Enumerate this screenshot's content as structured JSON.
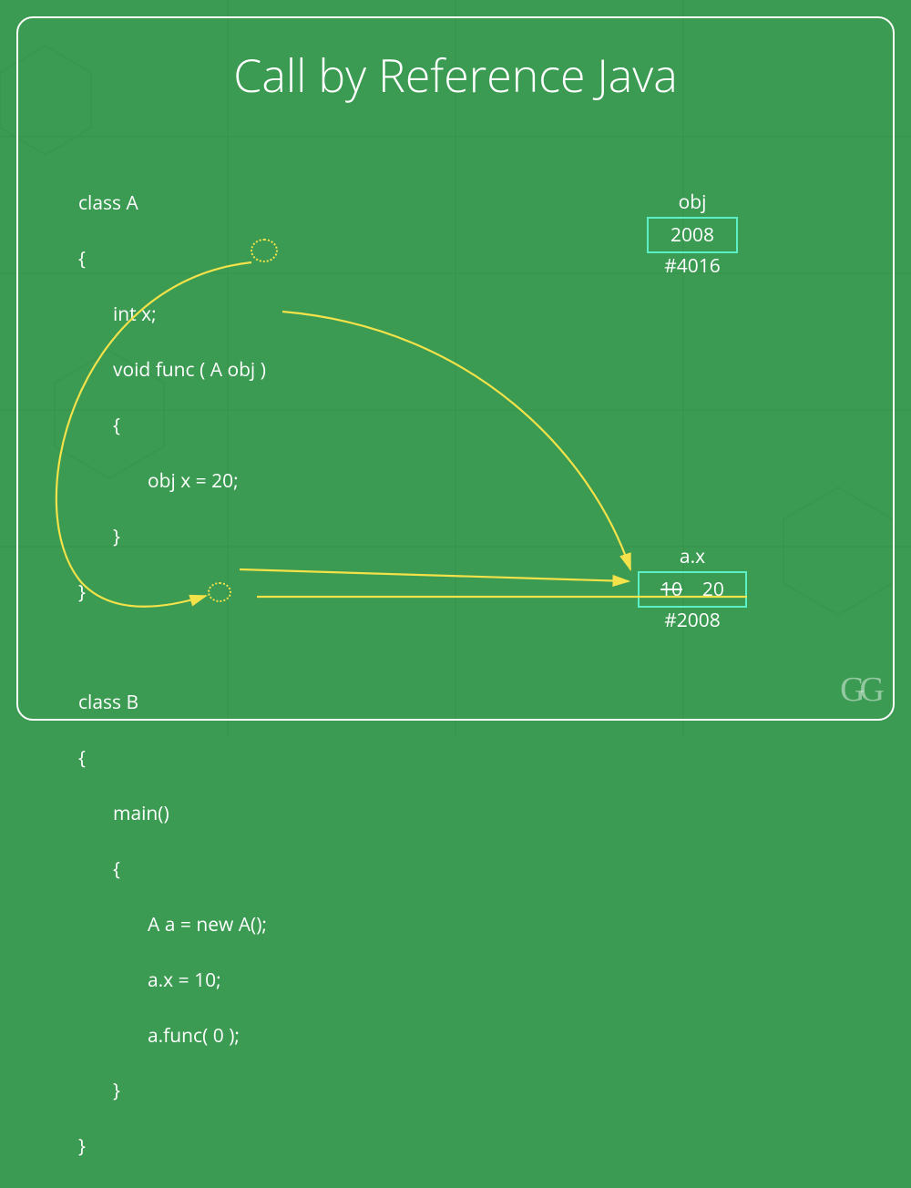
{
  "title": "Call by Reference Java",
  "code": {
    "l1": "class A",
    "l2": "{",
    "l3": "int x;",
    "l4a": "void func ( A ",
    "l4b": "obj",
    "l4c": " )",
    "l5": "{",
    "l6": "obj x = 20;",
    "l7": "}",
    "l8": "}",
    "l9": "class B",
    "l10": "{",
    "l11": "main()",
    "l12": "{",
    "l13": "A a = new A();",
    "l14": "a.x = 10;",
    "l15a": "a.func( ",
    "l15b": "0",
    "l15c": " );",
    "l16": "}",
    "l17": "}"
  },
  "memory": {
    "obj": {
      "label": "obj",
      "value": "2008",
      "addr": "#4016"
    },
    "ax": {
      "label": "a.x",
      "old": "10",
      "new": "20",
      "addr": "#2008"
    }
  },
  "colors": {
    "bg": "#3b9b52",
    "accent": "#5cf0c8",
    "highlight": "#f3e24a",
    "text": "#ffffff"
  },
  "logo": "GG"
}
